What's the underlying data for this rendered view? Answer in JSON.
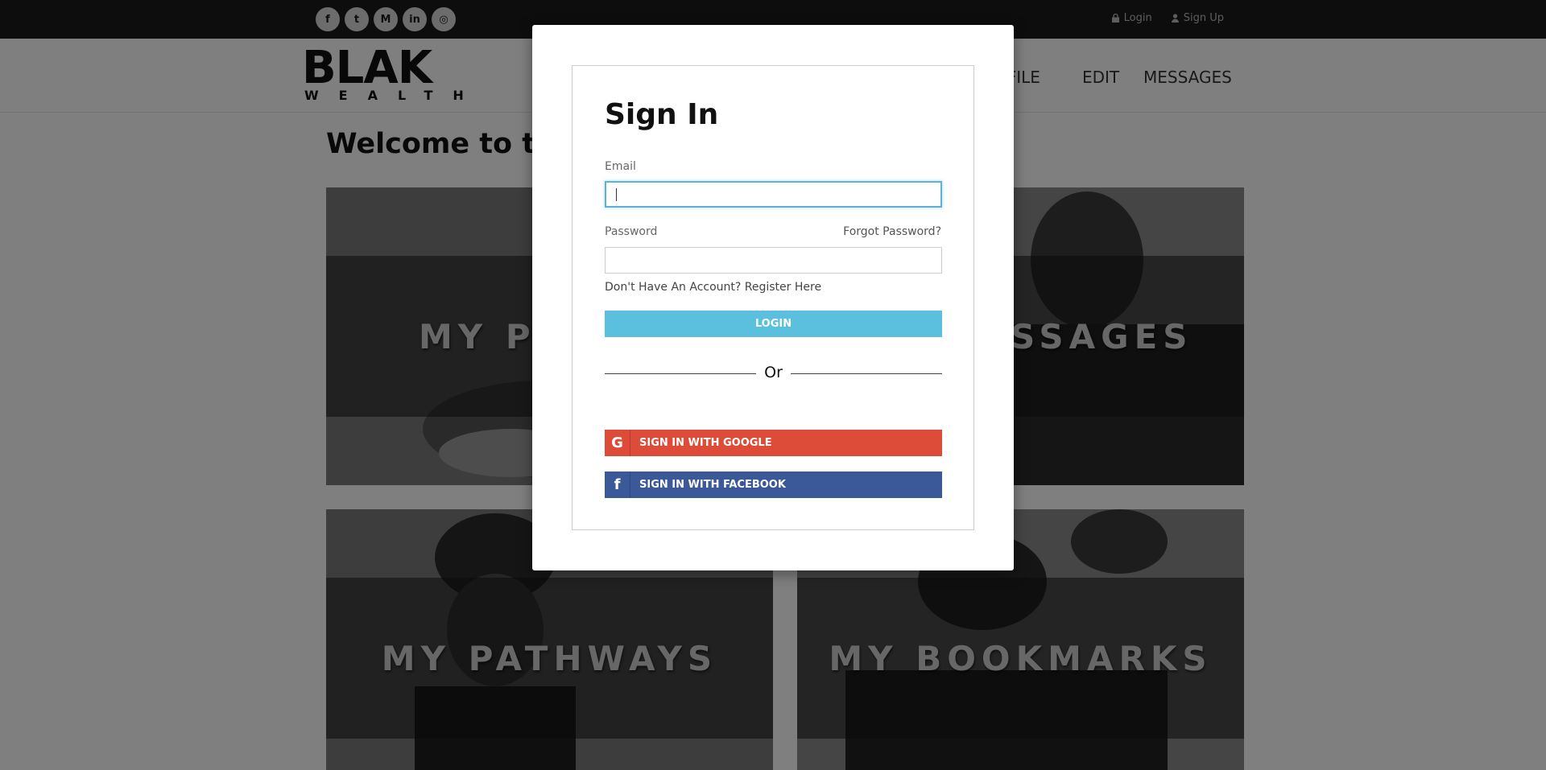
{
  "topbar": {
    "social_icons": [
      {
        "icon": "facebook-icon",
        "glyph": "f"
      },
      {
        "icon": "twitter-icon",
        "glyph": "t"
      },
      {
        "icon": "medium-icon",
        "glyph": "M"
      },
      {
        "icon": "linkedin-icon",
        "glyph": "in"
      },
      {
        "icon": "instagram-icon",
        "glyph": "◎"
      }
    ],
    "login_label": "Login",
    "signup_label": "Sign Up"
  },
  "header": {
    "logo_main": "BLAK",
    "logo_sub": "WEALTH",
    "nav": [
      "OFILE",
      "EDIT",
      "MESSAGES"
    ]
  },
  "main": {
    "welcome_text": "Welcome to th",
    "tiles": [
      "MY PI",
      "SSAGES",
      "MY PATHWAYS",
      "MY BOOKMARKS"
    ]
  },
  "modal": {
    "title": "Sign In",
    "email_label": "Email",
    "email_value": "",
    "password_label": "Password",
    "password_value": "",
    "forgot_label": "Forgot Password?",
    "register_label": "Don't Have An Account? Register Here",
    "login_button": "LOGIN",
    "or_label": "Or",
    "google_label": "SIGN IN WITH GOOGLE",
    "google_glyph": "G",
    "facebook_label": "SIGN IN WITH FACEBOOK",
    "facebook_glyph": "f"
  },
  "colors": {
    "login_button": "#5bc0de",
    "google": "#dd4b39",
    "facebook": "#3b5998",
    "topbar": "#1b1b1b"
  }
}
